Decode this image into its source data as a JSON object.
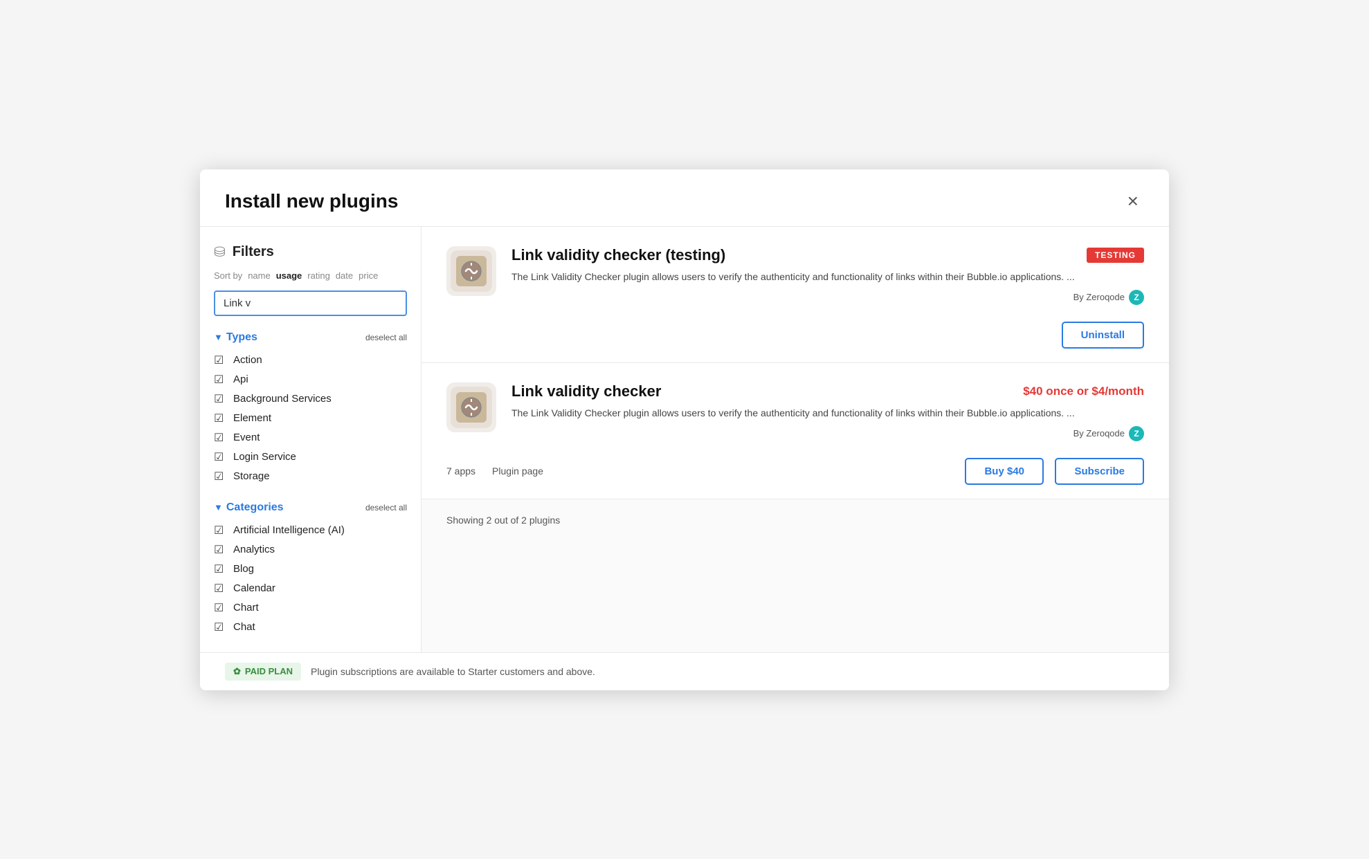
{
  "modal": {
    "title": "Install new plugins",
    "close_label": "×"
  },
  "sidebar": {
    "filter_label": "Filters",
    "sort_by_label": "Sort by",
    "sort_options": [
      "name",
      "usage",
      "date",
      "price"
    ],
    "sort_active": "usage",
    "search_value": "Link v",
    "search_placeholder": "",
    "types_section": {
      "label": "Types",
      "deselect_label": "deselect all",
      "items": [
        {
          "label": "Action",
          "checked": true
        },
        {
          "label": "Api",
          "checked": true
        },
        {
          "label": "Background Services",
          "checked": true
        },
        {
          "label": "Element",
          "checked": true
        },
        {
          "label": "Event",
          "checked": true
        },
        {
          "label": "Login Service",
          "checked": true
        },
        {
          "label": "Storage",
          "checked": true
        }
      ]
    },
    "categories_section": {
      "label": "Categories",
      "deselect_label": "deselect all",
      "items": [
        {
          "label": "Artificial Intelligence (AI)",
          "checked": true
        },
        {
          "label": "Analytics",
          "checked": true
        },
        {
          "label": "Blog",
          "checked": true
        },
        {
          "label": "Calendar",
          "checked": true
        },
        {
          "label": "Chart",
          "checked": true
        },
        {
          "label": "Chat",
          "checked": true
        }
      ]
    }
  },
  "plugins": [
    {
      "id": 1,
      "name": "Link validity checker (testing)",
      "badge_type": "testing",
      "badge_label": "TESTING",
      "description": "The Link Validity Checker plugin allows users to verify the authenticity and functionality of links within their Bubble.io applications. ...",
      "author": "By Zeroqode",
      "action_label": "Uninstall",
      "apps_count": null,
      "plugin_page_label": null
    },
    {
      "id": 2,
      "name": "Link validity checker",
      "badge_type": "price",
      "badge_label": "$40 once or $4/month",
      "description": "The Link Validity Checker plugin allows users to verify the authenticity and functionality of links within their Bubble.io applications. ...",
      "author": "By Zeroqode",
      "action_label": "Buy $40",
      "subscribe_label": "Subscribe",
      "apps_count": "7 apps",
      "plugin_page_label": "Plugin page"
    }
  ],
  "showing_count": "Showing 2 out of 2 plugins",
  "footer": {
    "badge_label": "PAID PLAN",
    "text": "Plugin subscriptions are available to Starter customers and above."
  }
}
